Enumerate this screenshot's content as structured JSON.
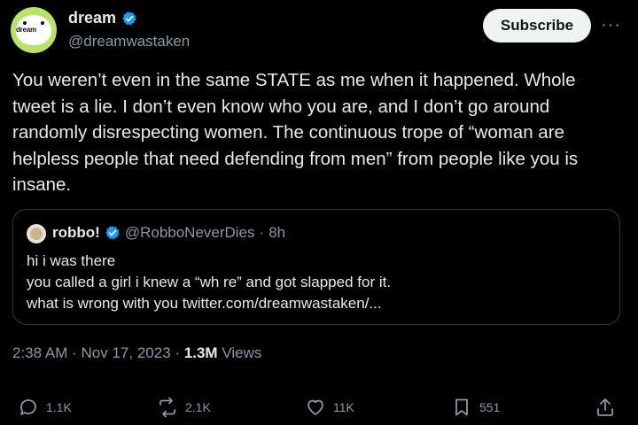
{
  "author": {
    "name": "dream",
    "handle": "@dreamwastaken",
    "avatar_text": "dream"
  },
  "subscribe_label": "Subscribe",
  "more_label": "···",
  "tweet_text": "You weren’t even in the same STATE as me when it happened. Whole\ntweet is a lie. I don’t even know who you are, and I don’t go around\nrandomly disrespecting women. The continuous trope of “woman are\nhelpless people that need defending from men”  from people like you is\ninsane.",
  "quote": {
    "name": "robbo!",
    "handle": "@RobboNeverDies",
    "dot": "·",
    "time": "8h",
    "text": "hi i was there\nyou called a girl i knew a “wh  re” and got slapped for it.\nwhat is wrong with you twitter.com/dreamwastaken/..."
  },
  "meta": {
    "time": "2:38 AM",
    "dot1": "·",
    "date": "Nov 17, 2023",
    "dot2": "·",
    "views_count": "1.3M",
    "views_label": "Views"
  },
  "actions": {
    "replies": "1.1K",
    "reposts": "2.1K",
    "likes": "11K",
    "bookmarks": "551"
  },
  "colors": {
    "background": "#000000",
    "text": "#e7e9ea",
    "muted": "#8b98a5",
    "verified": "#1d9bf0",
    "avatar": "#b8e36a"
  }
}
